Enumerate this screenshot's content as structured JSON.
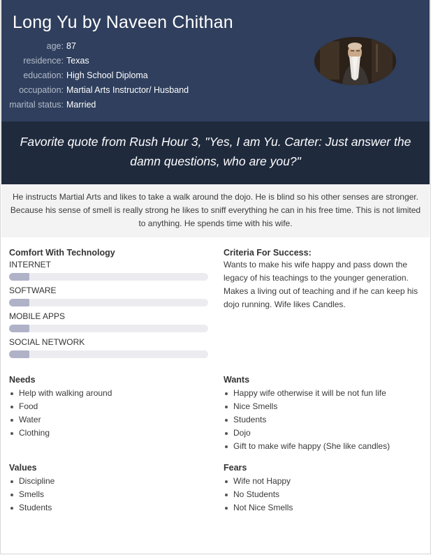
{
  "persona": {
    "title": "Long Yu by Naveen Chithan",
    "details": [
      {
        "label": "age:",
        "value": "87"
      },
      {
        "label": "residence:",
        "value": "Texas"
      },
      {
        "label": "education:",
        "value": "High School Diploma"
      },
      {
        "label": "occupation:",
        "value": "Martial Arts Instructor/ Husband"
      },
      {
        "label": "marital status:",
        "value": "Married"
      }
    ]
  },
  "quote": "Favorite quote from Rush Hour 3, \"Yes, I am Yu. Carter: Just answer the damn questions, who are you?\"",
  "bio": "He instructs Martial Arts and likes to take a walk around the dojo. He is blind so his other senses are stronger. Because his sense of smell is really strong he likes to sniff everything he can in his free time. This is not limited to anything. He spends time with his wife.",
  "technology": {
    "title": "Comfort With Technology",
    "items": [
      {
        "label": "INTERNET",
        "level": 0.1
      },
      {
        "label": "SOFTWARE",
        "level": 0.1
      },
      {
        "label": "MOBILE APPS",
        "level": 0.1
      },
      {
        "label": "SOCIAL NETWORK",
        "level": 0.1
      }
    ]
  },
  "criteria": {
    "title": "Criteria For Success:",
    "text": "Wants to make his wife happy and pass down the legacy of his teachings to the younger generation. Makes a living out of teaching and if he can keep his dojo running. Wife likes Candles."
  },
  "needs": {
    "title": "Needs",
    "items": [
      "Help with walking around",
      "Food",
      "Water",
      "Clothing"
    ]
  },
  "wants": {
    "title": "Wants",
    "items": [
      "Happy wife otherwise it will be not fun life",
      "Nice Smells",
      "Students",
      "Dojo",
      "Gift to make wife happy (She like candles)"
    ]
  },
  "values": {
    "title": "Values",
    "items": [
      "Discipline",
      "Smells",
      "Students"
    ]
  },
  "fears": {
    "title": "Fears",
    "items": [
      "Wife not Happy",
      "No Students",
      "Not Nice Smells"
    ]
  },
  "colors": {
    "header": "#2f3f5d",
    "quote_band": "#1f2a3d",
    "bio_background": "#f3f3f3",
    "bar_fill": "#b0b2c8",
    "bar_track": "#ececf0"
  },
  "avatar_icon": "persona-photo"
}
